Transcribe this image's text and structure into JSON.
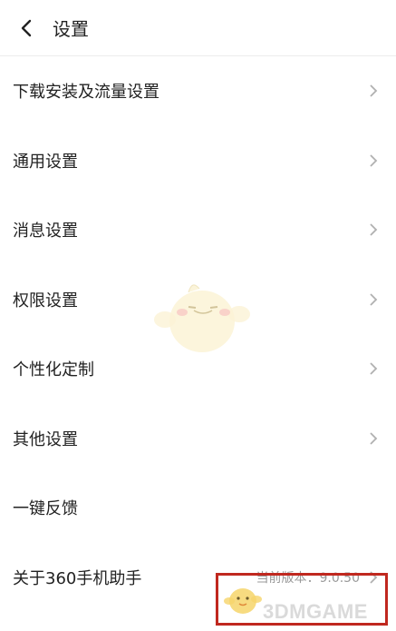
{
  "header": {
    "title": "设置",
    "back_icon": "chevron-left-icon"
  },
  "menu": {
    "items": [
      {
        "label": "下载安装及流量设置",
        "has_chevron": true
      },
      {
        "label": "通用设置",
        "has_chevron": true
      },
      {
        "label": "消息设置",
        "has_chevron": true
      },
      {
        "label": "权限设置",
        "has_chevron": true
      },
      {
        "label": "个性化定制",
        "has_chevron": true
      },
      {
        "label": "其他设置",
        "has_chevron": true
      },
      {
        "label": "一键反馈",
        "has_chevron": false
      },
      {
        "label": "关于360手机助手",
        "has_chevron": true,
        "value": "当前版本：9.0.50"
      }
    ]
  },
  "watermark": {
    "text": "3DMGAME"
  },
  "colors": {
    "highlight_border": "#c0281f",
    "chevron": "#b0b0b0",
    "secondary_text": "#999999"
  }
}
